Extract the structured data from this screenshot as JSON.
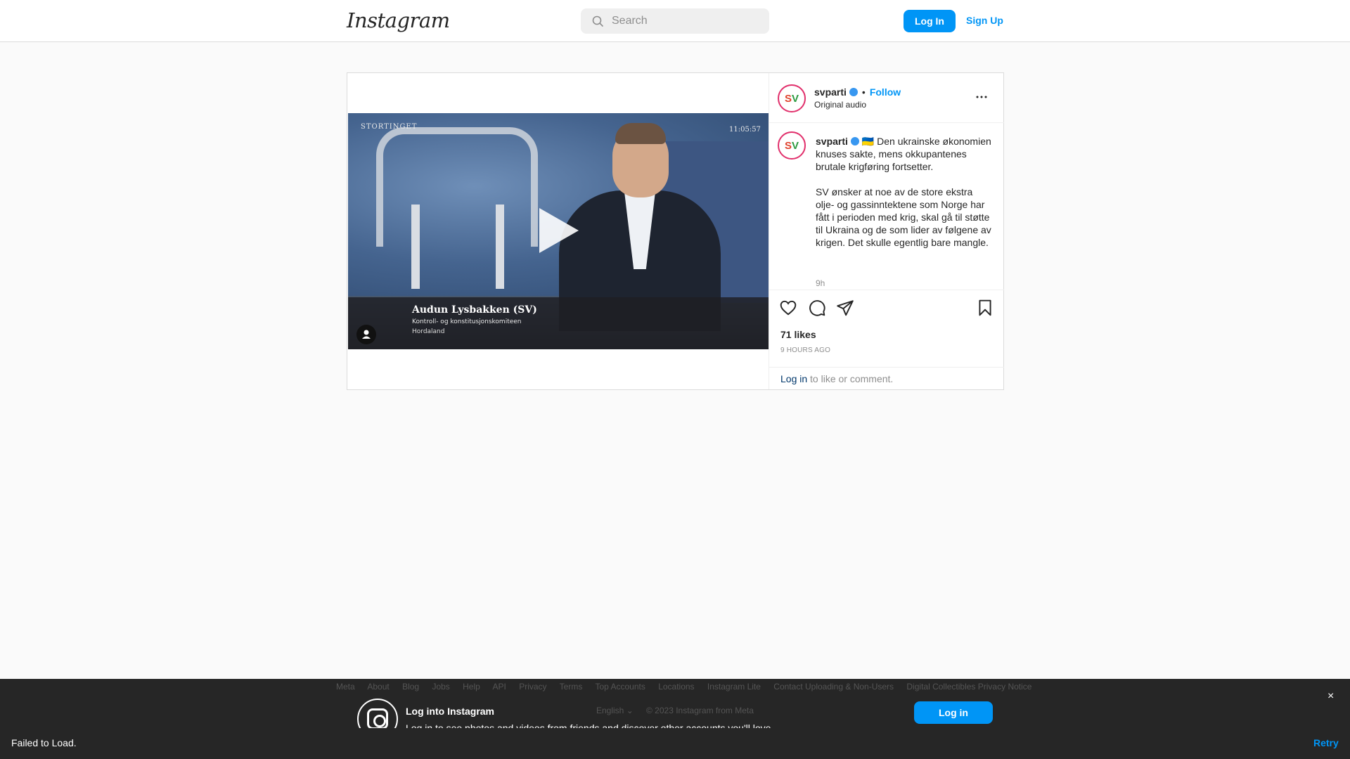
{
  "topnav": {
    "logo": "Instagram",
    "search_placeholder": "Search",
    "login_label": "Log In",
    "signup_label": "Sign Up"
  },
  "video": {
    "channel_watermark": "STORTINGET",
    "clock": "11:05:57",
    "speaker_name": "Audun Lysbakken (SV)",
    "speaker_committee": "Kontroll- og konstitusjonskomiteen",
    "speaker_county": "Hordaland"
  },
  "post_header": {
    "username": "svparti",
    "separator": "•",
    "follow_label": "Follow",
    "audio_label": "Original audio"
  },
  "caption": {
    "username": "svparti",
    "flag": "🇺🇦",
    "text": "Den ukrainske økonomien knuses sakte, mens okkupantenes brutale krigføring fortsetter.\n\nSV ønsker at noe av de store ekstra olje- og gassinntektene som Norge har fått i perioden med krig, skal gå til støtte til Ukraina og de som lider av følgene av krigen. Det skulle egentlig bare mangle.",
    "time": "9h"
  },
  "actions": {
    "icons": [
      "heart-icon",
      "comment-icon",
      "share-icon",
      "bookmark-icon"
    ],
    "likes": "71 likes",
    "ago": "9 HOURS AGO",
    "login_link": "Log in",
    "login_suffix": " to like or comment."
  },
  "footer": {
    "links": [
      "Meta",
      "About",
      "Blog",
      "Jobs",
      "Help",
      "API",
      "Privacy",
      "Terms",
      "Top Accounts",
      "Locations",
      "Instagram Lite",
      "Contact Uploading & Non-Users",
      "Digital Collectibles Privacy Notice"
    ],
    "language": "English",
    "copyright": "© 2023 Instagram from Meta"
  },
  "banner": {
    "title": "Log into Instagram",
    "subtitle": "Log in to see photos and videos from friends and discover other accounts you'll love.",
    "login_label": "Log in",
    "close": "×"
  },
  "error_bar": {
    "message": "Failed to Load.",
    "retry_label": "Retry"
  },
  "colors": {
    "accent": "#0095f6",
    "border": "#dbdbdb",
    "background": "#fafafa",
    "banner": "#262626"
  }
}
